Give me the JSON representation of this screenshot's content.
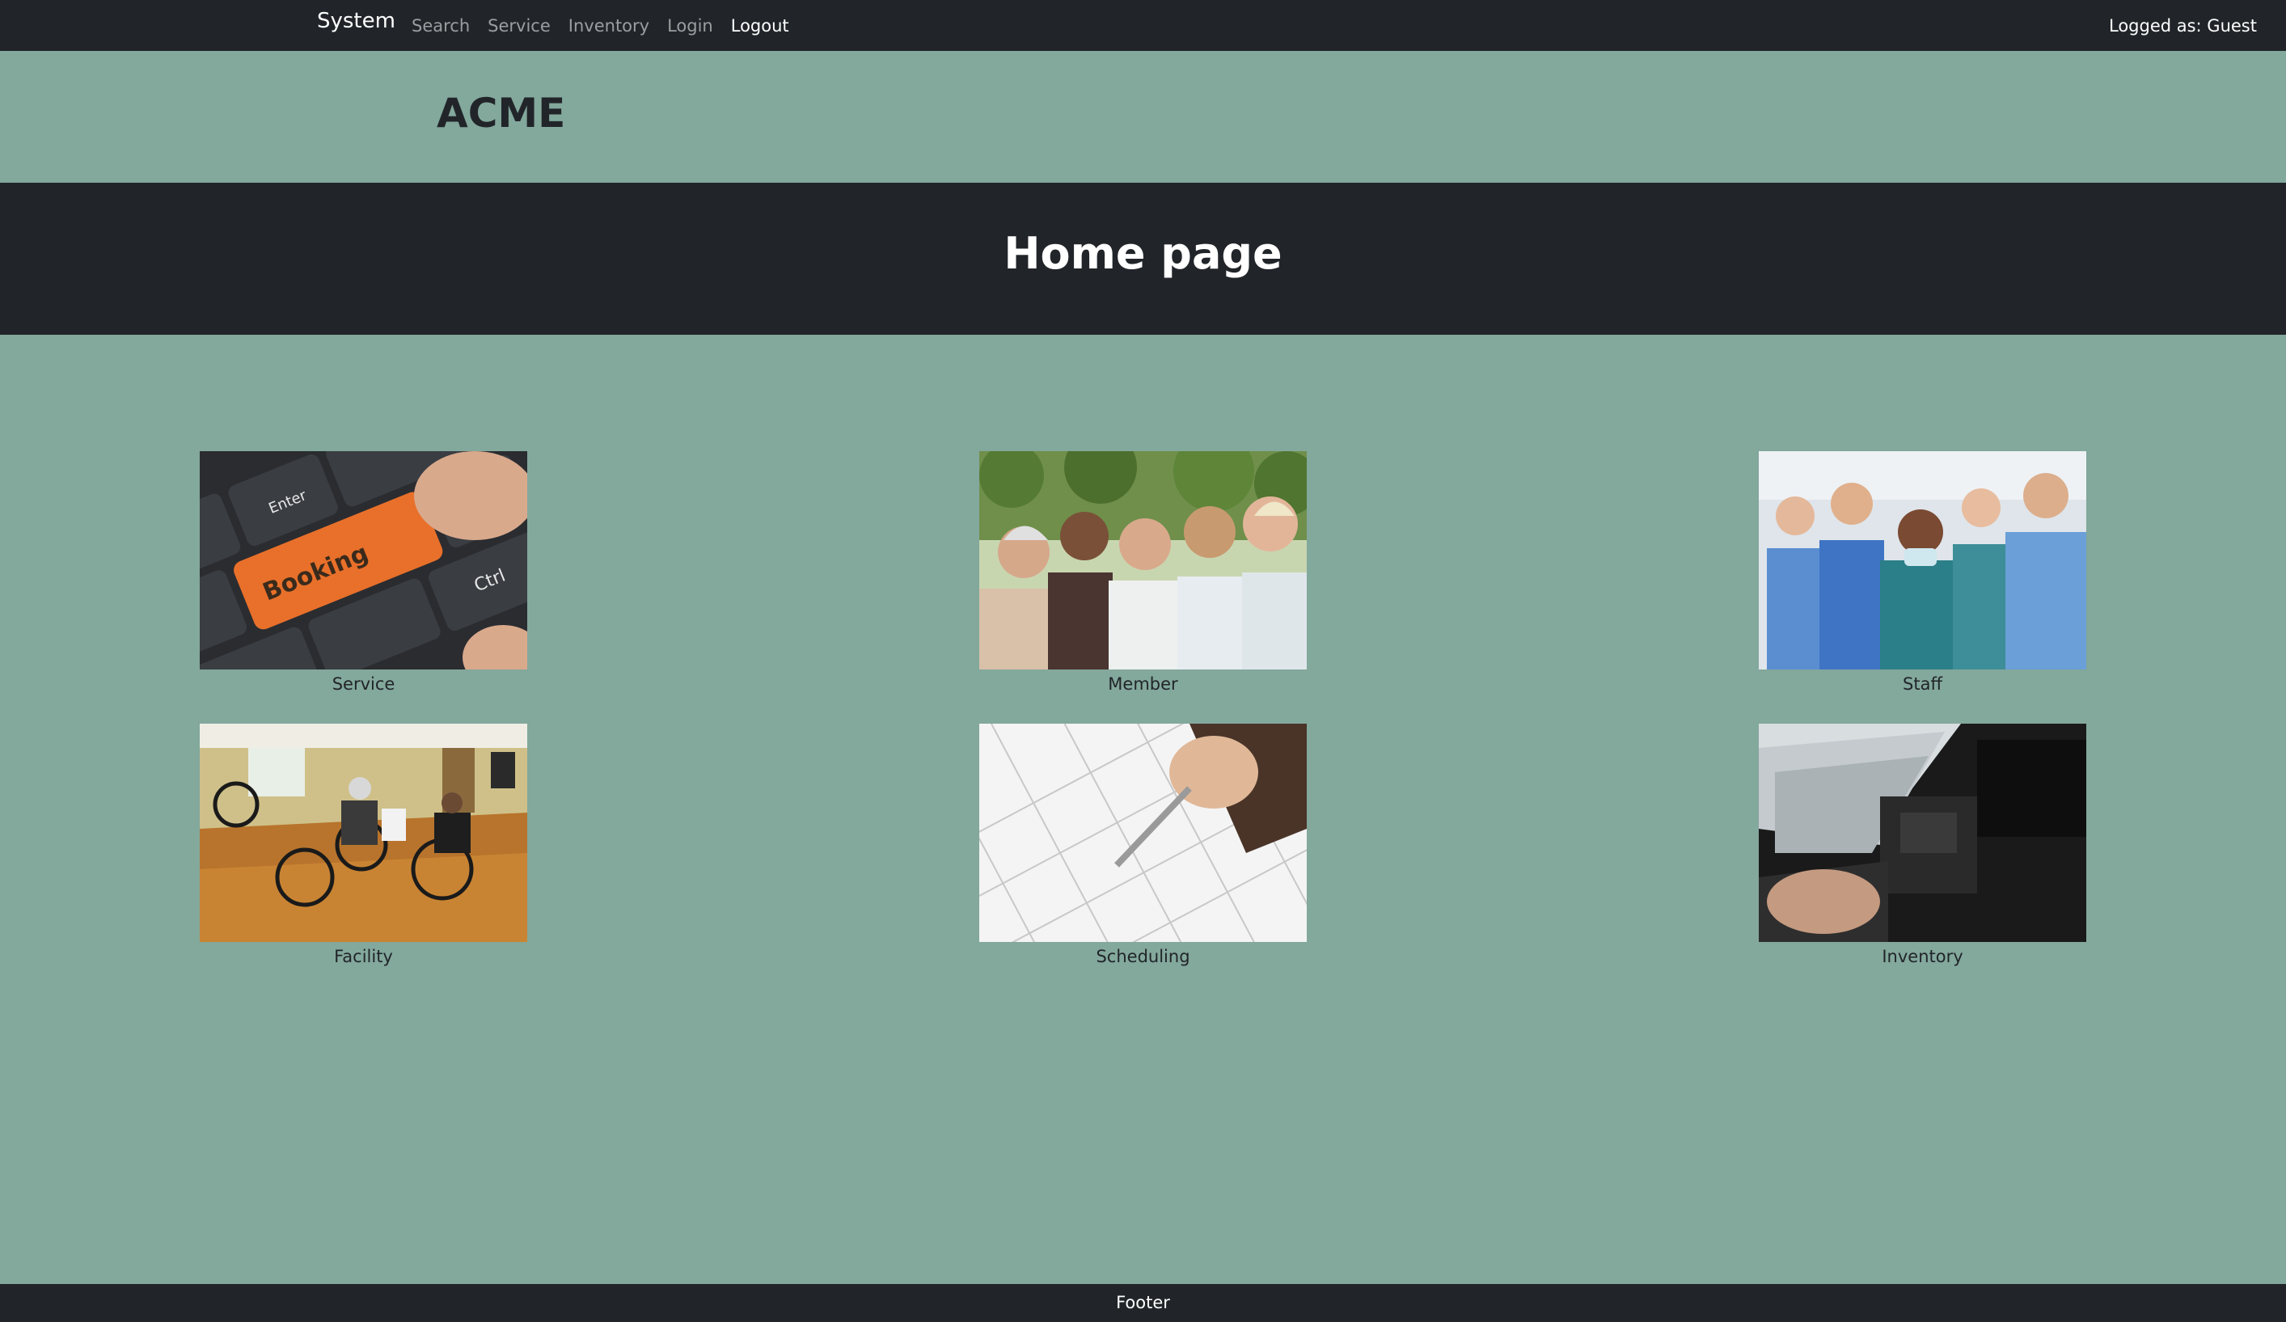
{
  "navbar": {
    "brand": "System",
    "links": [
      {
        "label": "Search"
      },
      {
        "label": "Service"
      },
      {
        "label": "Inventory"
      },
      {
        "label": "Login"
      },
      {
        "label": "Logout"
      }
    ],
    "user_status": "Logged as: Guest"
  },
  "header": {
    "site_name": "ACME"
  },
  "hero": {
    "title": "Home page"
  },
  "tiles": [
    {
      "caption": "Service",
      "key_label": "Booking",
      "enter_label": "Enter",
      "ctrl_label": "Ctrl"
    },
    {
      "caption": "Member"
    },
    {
      "caption": "Staff"
    },
    {
      "caption": "Facility"
    },
    {
      "caption": "Scheduling"
    },
    {
      "caption": "Inventory"
    }
  ],
  "footer": {
    "text": "Footer"
  },
  "colors": {
    "page_bg": "#83a89c",
    "dark_bar": "#212529",
    "booking_key": "#e8702a"
  }
}
